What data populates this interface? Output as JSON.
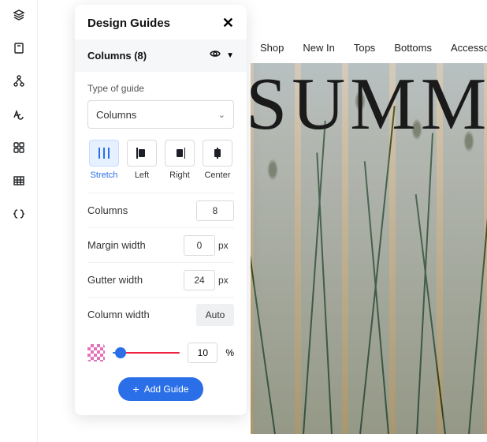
{
  "panel": {
    "title": "Design Guides",
    "section_label": "Columns (8)",
    "type_label": "Type of guide",
    "type_value": "Columns",
    "alignments": [
      {
        "key": "stretch",
        "label": "Stretch",
        "active": true
      },
      {
        "key": "left",
        "label": "Left",
        "active": false
      },
      {
        "key": "right",
        "label": "Right",
        "active": false
      },
      {
        "key": "center",
        "label": "Center",
        "active": false
      }
    ],
    "fields": {
      "columns": {
        "label": "Columns",
        "value": "8"
      },
      "margin": {
        "label": "Margin width",
        "value": "0",
        "unit": "px"
      },
      "gutter": {
        "label": "Gutter width",
        "value": "24",
        "unit": "px"
      },
      "colwidth": {
        "label": "Column width",
        "value": "Auto"
      }
    },
    "opacity": {
      "value": "10",
      "unit": "%"
    },
    "add_label": "Add Guide"
  },
  "canvas": {
    "nav": [
      "Shop",
      "New In",
      "Tops",
      "Bottoms",
      "Accesso"
    ],
    "hero": "SUMM"
  }
}
